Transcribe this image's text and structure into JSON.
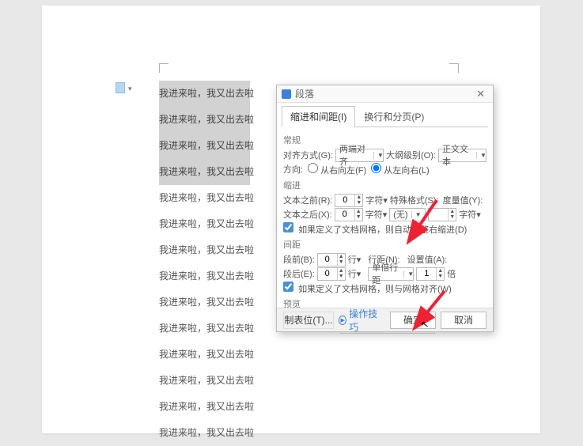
{
  "document": {
    "lines": [
      "我进来啦，我又出去啦",
      "我进来啦，我又出去啦",
      "我进来啦，我又出去啦",
      "我进来啦，我又出去啦",
      "我进来啦，我又出去啦",
      "我进来啦，我又出去啦",
      "我进来啦，我又出去啦",
      "我进来啦，我又出去啦",
      "我进来啦，我又出去啦",
      "我进来啦，我又出去啦",
      "我进来啦，我又出去啦",
      "我进来啦，我又出去啦",
      "我进来啦，我又出去啦",
      "我进来啦，我又出去啦"
    ],
    "selected_count": 4
  },
  "dialog": {
    "title": "段落",
    "tabs": {
      "indent": "缩进和间距(I)",
      "pagebreak": "换行和分页(P)"
    },
    "general_title": "常规",
    "align_label": "对齐方式(G):",
    "align_value": "两端对齐",
    "outline_label": "大纲级别(O):",
    "outline_value": "正文文本",
    "direction_label": "方向:",
    "rtl": "从右向左(F)",
    "ltr": "从左向右(L)",
    "indent_title": "缩进",
    "before_text_label": "文本之前(R):",
    "before_text_value": "0",
    "before_text_unit": "字符▾",
    "after_text_label": "文本之后(X):",
    "after_text_value": "0",
    "after_text_unit": "字符▾",
    "special_label": "特殊格式(S):",
    "special_value": "(无)",
    "measure_label": "度量值(Y):",
    "measure_value": "",
    "measure_unit": "字符▾",
    "auto_adjust": "如果定义了文档网格，则自动调整右缩进(D)",
    "spacing_title": "间距",
    "before_label": "段前(B):",
    "before_value": "0",
    "before_unit": "行▾",
    "after_label": "段后(E):",
    "after_value": "0",
    "after_unit": "行▾",
    "linespace_label": "行距(N):",
    "linespace_value": "单倍行距",
    "setvalue_label": "设置值(A):",
    "setvalue_value": "1",
    "setvalue_unit": "倍",
    "grid_align": "如果定义了文档网格，则与网格对齐(W)",
    "preview_title": "预览",
    "tabstops": "制表位(T)...",
    "tips": "操作技巧",
    "ok": "确定",
    "cancel": "取消"
  }
}
